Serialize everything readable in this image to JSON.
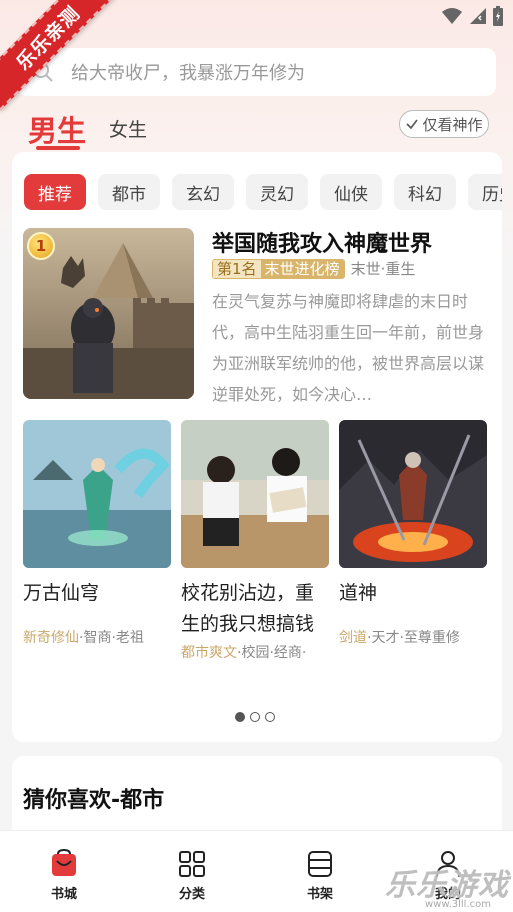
{
  "ribbon": "乐乐亲测",
  "search": {
    "placeholder": "给大帝收尸，我暴涨万年修为"
  },
  "gender_tabs": {
    "male": "男生",
    "female": "女生"
  },
  "filter": {
    "label": "仅看神作"
  },
  "categories": [
    "推荐",
    "都市",
    "玄幻",
    "灵幻",
    "仙侠",
    "科幻",
    "历史"
  ],
  "featured": {
    "rank": "1",
    "title": "举国随我攻入神魔世界",
    "rank_tag_a": "第1名",
    "rank_tag_b": "末世进化榜",
    "genre": "末世·重生",
    "desc": "在灵气复苏与神魔即将肆虐的末日时代，高中生陆羽重生回一年前，前世身为亚洲联军统帅的他，被世界高层以谋逆罪处死，如今决心…"
  },
  "books": [
    {
      "title": "万古仙穹",
      "tag_hl": "新奇修仙",
      "tags": "·智商·老祖"
    },
    {
      "title": "校花别沾边，重生的我只想搞钱",
      "tag_hl": "都市爽文",
      "tags": "·校园·经商·"
    },
    {
      "title": "道神",
      "tag_hl": "剑道",
      "tags": "·天才·至尊重修"
    }
  ],
  "guess": {
    "title": "猜你喜欢-都市"
  },
  "nav": [
    {
      "label": "书城"
    },
    {
      "label": "分类"
    },
    {
      "label": "书架"
    },
    {
      "label": "我的"
    }
  ],
  "watermark": {
    "main": "乐乐游戏",
    "sub": "www.3lll.com"
  },
  "colors": {
    "accent": "#e33b3b",
    "gold": "#c9a86a"
  }
}
